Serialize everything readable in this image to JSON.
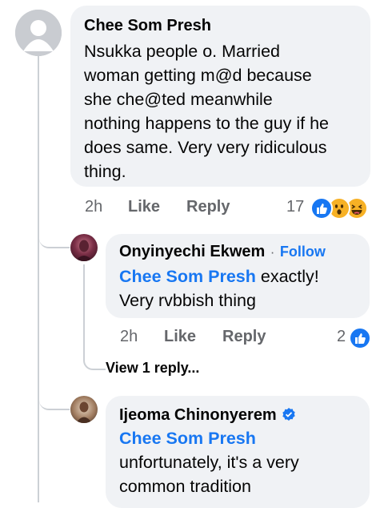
{
  "comment": {
    "author": "Chee Som Presh",
    "lines": [
      "Nsukka people o. Married",
      "woman getting m@d because",
      "she che@ted meanwhile",
      "nothing happens to the guy if he",
      "does same. Very very ridiculous",
      "thing."
    ],
    "time": "2h",
    "like_label": "Like",
    "reply_label": "Reply",
    "reaction_count": "17",
    "reactions": [
      "like-icon",
      "wow-icon",
      "haha-icon"
    ]
  },
  "reply1": {
    "author": "Onyinyechi Ekwem",
    "separator": "·",
    "follow_label": "Follow",
    "mention": "Chee Som Presh",
    "text_inline": "exactly!",
    "text_line2": "Very rvbbish thing",
    "time": "2h",
    "like_label": "Like",
    "reply_label": "Reply",
    "reaction_count": "2",
    "reactions": [
      "like-icon"
    ]
  },
  "view_replies": "View 1 reply...",
  "reply2": {
    "author": "Ijeoma Chinonyerem",
    "verified_icon": "verified-badge-icon",
    "mention": "Chee Som Presh",
    "line1": "unfortunately, it's a very",
    "line2": "common tradition"
  },
  "colors": {
    "accent": "#1877f2",
    "bubble": "#f0f2f5",
    "meta": "#65676b",
    "thread": "#ccd0d5"
  }
}
